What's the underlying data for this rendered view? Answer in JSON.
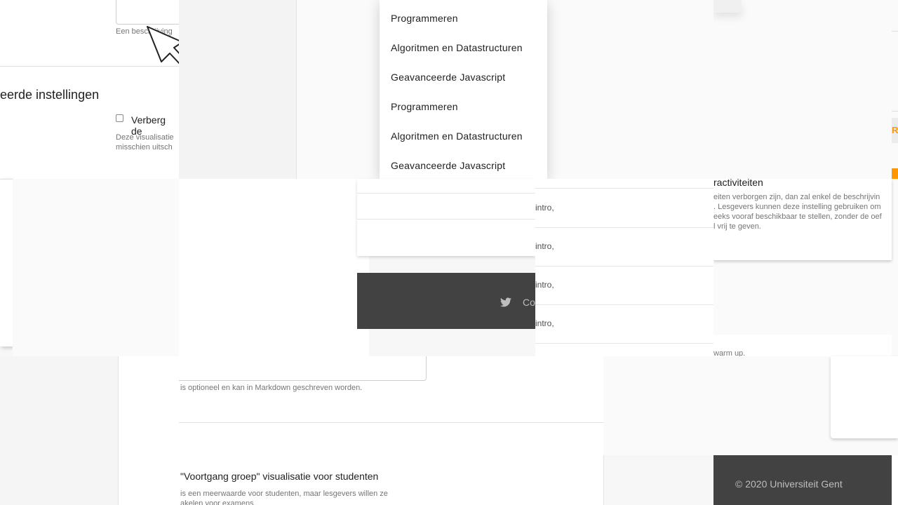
{
  "colors": {
    "accent": "#ff9800",
    "footer_bg": "#424242",
    "page_bg": "#f7f7f7"
  },
  "top_left_fragment": {
    "field_hint": "Een beschrijving",
    "section_title": "eerde instellingen",
    "checkbox_label": "Verberg de",
    "help_text_line1": "Deze visualisatie",
    "help_text_line2": "misschien uitsch"
  },
  "dropdown": {
    "items": [
      "Programmeren",
      "Algoritmen en Datastructuren",
      "Geavanceerde Javascript",
      "Programmeren",
      "Algoritmen en Datastructuren",
      "Geavanceerde Javascript"
    ]
  },
  "right_fragment": {
    "checkbox_label": "ractiviteiten",
    "help_line1": "eiten verborgen zijn, dan zal enkel de beschrijvin",
    "help_line2": ". Lesgevers kunnen deze instelling gebruiken om",
    "help_line3": "eeks vooraf beschikbaar te stellen, zonder de oef",
    "help_line4": "l vrij te geven.",
    "accent_text": "R",
    "warmup_text": "warm up."
  },
  "list_rows": [
    "intro,",
    "intro,",
    "intro,",
    "intro,"
  ],
  "footer_mid": {
    "text": "Co"
  },
  "bottom_form": {
    "textarea_hint": "is optioneel en kan in Markdown geschreven worden.",
    "checkbox_title": "\"Voortgang groep\" visualisatie voor studenten",
    "help_line1": "is een meerwaarde voor studenten, maar lesgevers willen ze",
    "help_line2": "akelen voor examens."
  },
  "footer_right": {
    "copyright": "© 2020 Universiteit Gent"
  }
}
